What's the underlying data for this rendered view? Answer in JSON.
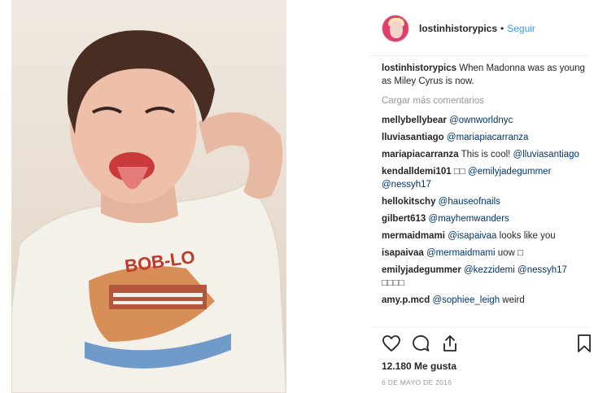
{
  "post": {
    "author": {
      "username": "lostinhistorypics",
      "separator": "•",
      "follow_label": "Seguir"
    },
    "caption": {
      "username": "lostinhistorypics",
      "text": "When Madonna was as young as Miley Cyrus is now."
    },
    "load_more_label": "Cargar más comentarios",
    "comments": [
      {
        "username": "mellybellybear",
        "mention": "@ownworldnyc",
        "text": ""
      },
      {
        "username": "lluviasantiago",
        "mention": "@mariapiacarranza",
        "text": ""
      },
      {
        "username": "mariapiacarranza",
        "text_before": "This is cool!",
        "mention": "@lluviasantiago"
      },
      {
        "username": "kendalldemi101",
        "text_before": "□□",
        "mention": "@emilyjadegummer",
        "mention2": "@nessyh17"
      },
      {
        "username": "hellokitschy",
        "mention": "@hauseofnails",
        "text": ""
      },
      {
        "username": "gilbert613",
        "mention": "@mayhemwanders",
        "text": ""
      },
      {
        "username": "mermaidmami",
        "mention": "@isapaivaa",
        "text": "looks like you"
      },
      {
        "username": "isapaivaa",
        "mention": "@mermaidmami",
        "text": "uow □"
      },
      {
        "username": "emilyjadegummer",
        "mention": "@kezzidemi",
        "mention2": "@nessyh17",
        "text": "□□□□"
      },
      {
        "username": "amy.p.mcd",
        "mention": "@sophiee_leigh",
        "text": "weird"
      }
    ],
    "actions": {
      "like_icon": "heart-outline-icon",
      "comment_icon": "comment-bubble-icon",
      "share_icon": "share-arrow-icon",
      "save_icon": "bookmark-icon"
    },
    "likes": "12.180 Me gusta",
    "date": "6 DE MAYO DE 2016",
    "colors": {
      "link": "#3897f0",
      "mention": "#003569",
      "muted": "#999999"
    },
    "photo": {
      "shirt_text": "BOB-LO"
    }
  }
}
